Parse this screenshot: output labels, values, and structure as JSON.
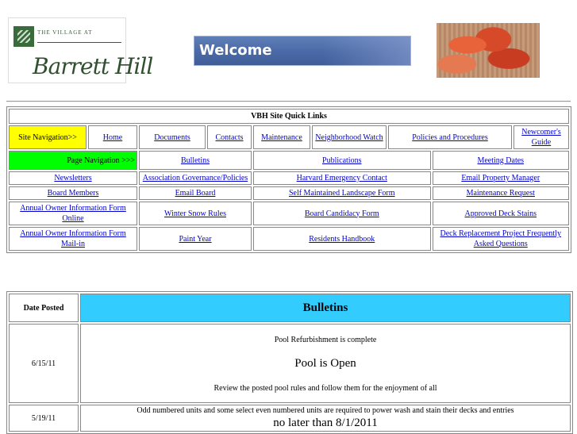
{
  "header": {
    "logo_small": "THE VILLAGE AT",
    "logo_script": "Barrett Hill",
    "welcome": "Welcome"
  },
  "quick_links": {
    "title": "VBH Site Quick Links",
    "site_nav_label": "Site Navigation>>",
    "page_nav_label": "Page Navigation >>>",
    "site_nav": [
      "Home",
      "Documents",
      "Contacts",
      "Maintenance",
      "Neighborhood Watch",
      "Policies and Procedures",
      "Newcomer's Guide"
    ],
    "page_nav": [
      "Bulletins",
      "Publications",
      "Meeting Dates"
    ],
    "rows": [
      [
        "Newsletters",
        "Association Governance/Policies",
        "Harvard Emergency Contact",
        "Email Property Manager"
      ],
      [
        "Board Members",
        "Email Board",
        "Self Maintained Landscape Form",
        "Maintenance Request"
      ],
      [
        "Annual Owner Information Form Online",
        "Winter Snow Rules",
        "Board Candidacy Form",
        "Approved Deck Stains"
      ],
      [
        "Annual Owner Information Form Mail-in",
        "Paint Year",
        "Residents Handbook",
        "Deck Replacement Project Frequently Asked Questions"
      ]
    ]
  },
  "bulletins": {
    "date_header": "Date Posted",
    "title": "Bulletins",
    "entries": [
      {
        "date": "6/15/11",
        "line1": "Pool Refurbishment is complete",
        "headline": "Pool is Open",
        "line2": "Review the posted pool rules and follow them for the enjoyment of all"
      },
      {
        "date": "5/19/11",
        "line1": "Odd numbered units and some select even numbered units are required to power wash and stain their decks and entries",
        "headline": "no later than 8/1/2011"
      }
    ]
  }
}
